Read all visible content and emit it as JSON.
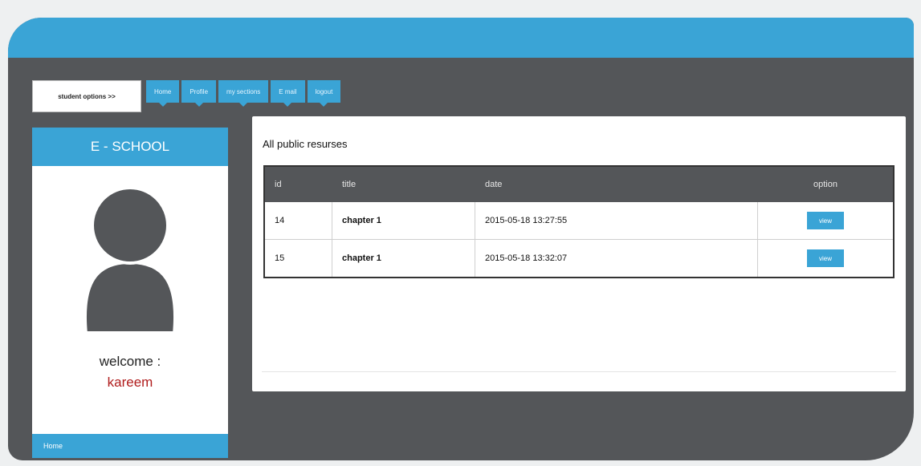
{
  "header": {
    "options_label": "student options >>",
    "nav": [
      "Home",
      "Profile",
      "my sections",
      "E mail",
      "logout"
    ]
  },
  "sidebar": {
    "brand": "E - SCHOOL",
    "welcome_label": "welcome :",
    "username": "kareem",
    "footer_label": "Home"
  },
  "main": {
    "title": "All public resurses",
    "columns": [
      "id",
      "title",
      "date",
      "option"
    ],
    "rows": [
      {
        "id": "14",
        "title": "chapter 1",
        "date": "2015-05-18 13:27:55",
        "action": "view"
      },
      {
        "id": "15",
        "title": "chapter 1",
        "date": "2015-05-18 13:32:07",
        "action": "view"
      }
    ]
  },
  "colors": {
    "accent": "#3aa4d6",
    "frame": "#545659",
    "username": "#b01c1c"
  }
}
